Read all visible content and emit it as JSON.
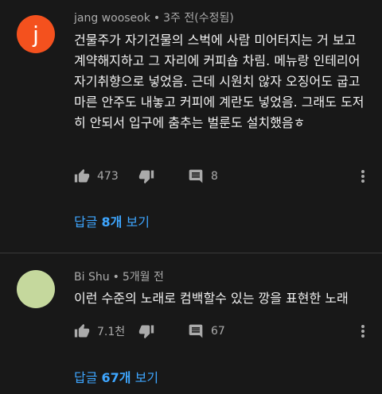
{
  "comments": [
    {
      "avatar_letter": "j",
      "avatar_color": "#f4511e",
      "author": "jang wooseok",
      "separator": "•",
      "time": "3주 전(수정됨)",
      "text": "건물주가 자기건물의 스벅에 사람 미어터지는 거 보고 계약해지하고 그 자리에 커피숍 차림. 메뉴랑 인테리어 자기취향으로 넣었음. 근데 시원치 않자 오징어도 굽고 마른 안주도 내놓고 커피에 계란도 넣었음. 그래도 도저히 안되서 입구에 춤추는 벌룬도 설치했음ㅎ",
      "likes": "473",
      "replies_count": "8",
      "replies_prefix": "답글 ",
      "replies_num": "8개",
      "replies_suffix": " 보기"
    },
    {
      "avatar_letter": "",
      "avatar_color": "#c5d89d",
      "author": "Bi Shu",
      "separator": "•",
      "time": "5개월 전",
      "text": "이런 수준의 노래로 컴백할수 있는 깡을 표현한 노래",
      "likes": "7.1천",
      "replies_count": "67",
      "replies_prefix": "답글 ",
      "replies_num": "67개",
      "replies_suffix": " 보기"
    }
  ]
}
